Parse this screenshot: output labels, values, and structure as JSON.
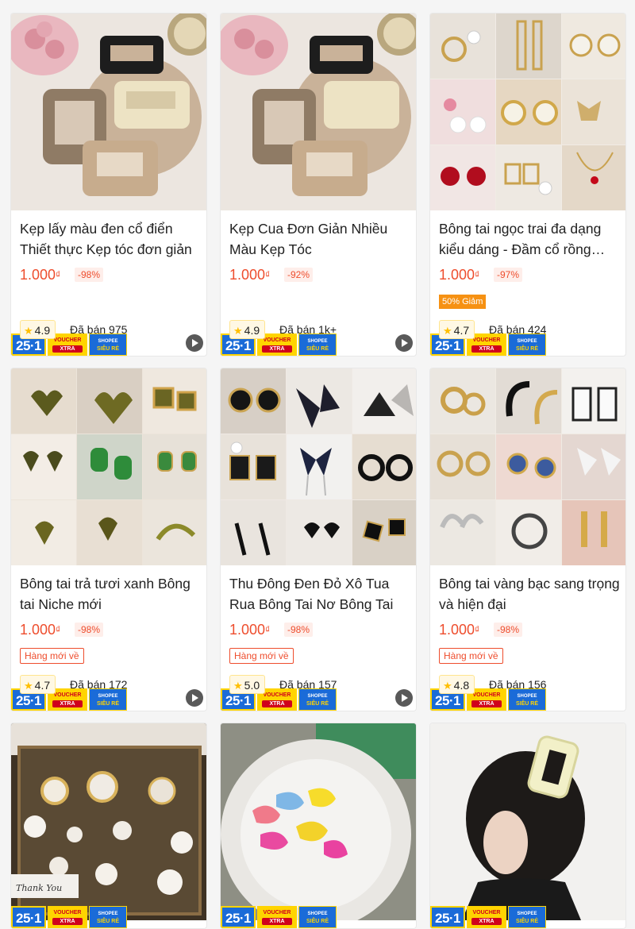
{
  "colors": {
    "price": "#ee4d2d",
    "badge_blue": "#1a6bd8",
    "badge_yellow": "#ffd400",
    "sale_tag": "#f69113"
  },
  "badges": {
    "campaign": "25·1",
    "voucher": "VOUCHER",
    "voucher_x": "XTRA",
    "shopee": "SHOPEE",
    "shopee_sub": "SIÊU RẺ"
  },
  "products": [
    {
      "title": "Kẹp lấy màu đen cổ điển Thiết thực Kẹp tóc đơn giản",
      "price": "1.000",
      "currency": "₫",
      "discount": "-98%",
      "tag": "",
      "rating": "4.9",
      "sold": "Đã bán 975",
      "video": true
    },
    {
      "title": "Kẹp Cua Đơn Giản Nhiều Màu Kẹp Tóc",
      "price": "1.000",
      "currency": "₫",
      "discount": "-92%",
      "tag": "",
      "rating": "4.9",
      "sold": "Đã bán 1k+",
      "video": true
    },
    {
      "title": "Bông tai ngọc trai đa dạng kiểu dáng - Đầm cổ rồng vàng",
      "price": "1.000",
      "currency": "₫",
      "discount": "-97%",
      "tag": "50% Giảm",
      "rating": "4.7",
      "sold": "Đã bán 424",
      "video": false
    },
    {
      "title": "Bông tai trả tươi xanh Bông tai Niche mới",
      "price": "1.000",
      "currency": "₫",
      "discount": "-98%",
      "tag": "Hàng mới về",
      "rating": "4.7",
      "sold": "Đã bán 172",
      "video": true
    },
    {
      "title": "Thu Đông Đen Đỏ Xô Tua Rua Bông Tai Nơ Bông Tai",
      "price": "1.000",
      "currency": "₫",
      "discount": "-98%",
      "tag": "Hàng mới về",
      "rating": "5.0",
      "sold": "Đã bán 157",
      "video": true
    },
    {
      "title": "Bông tai vàng bạc sang trọng và hiện đại",
      "price": "1.000",
      "currency": "₫",
      "discount": "-98%",
      "tag": "Hàng mới về",
      "rating": "4.8",
      "sold": "Đã bán 156",
      "video": false
    },
    {
      "video": false
    },
    {
      "video": false
    },
    {
      "video": false
    }
  ],
  "image_overlay_texts": {
    "thank_you": "Thank You"
  }
}
